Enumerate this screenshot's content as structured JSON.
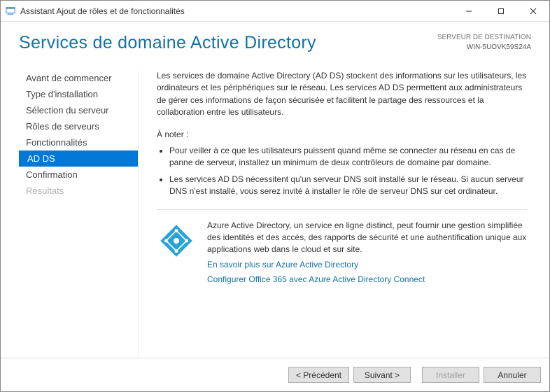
{
  "window": {
    "title": "Assistant Ajout de rôles et de fonctionnalités"
  },
  "header": {
    "page_title": "Services de domaine Active Directory",
    "destination_label": "SERVEUR DE DESTINATION",
    "destination_value": "WIN-5UOVK59S24A"
  },
  "nav": {
    "items": [
      {
        "label": "Avant de commencer",
        "state": "normal"
      },
      {
        "label": "Type d'installation",
        "state": "normal"
      },
      {
        "label": "Sélection du serveur",
        "state": "normal"
      },
      {
        "label": "Rôles de serveurs",
        "state": "normal"
      },
      {
        "label": "Fonctionnalités",
        "state": "normal"
      },
      {
        "label": "AD DS",
        "state": "selected"
      },
      {
        "label": "Confirmation",
        "state": "normal"
      },
      {
        "label": "Résultats",
        "state": "disabled"
      }
    ]
  },
  "main": {
    "intro": "Les services de domaine Active Directory (AD DS) stockent des informations sur les utilisateurs, les ordinateurs et les périphériques sur le réseau. Les services AD DS permettent aux administrateurs de gérer ces informations de façon sécurisée et facilitent le partage des ressources et la collaboration entre les utilisateurs.",
    "notes_heading": "À noter :",
    "notes": [
      "Pour veiller à ce que les utilisateurs puissent quand même se connecter au réseau en cas de panne de serveur, installez un minimum de deux contrôleurs de domaine par domaine.",
      "Les services AD DS nécessitent qu'un serveur DNS soit installé sur le réseau. Si aucun serveur DNS n'est installé, vous serez invité à installer le rôle de serveur DNS sur cet ordinateur."
    ],
    "azure": {
      "text": "Azure Active Directory, un service en ligne distinct, peut fournir une gestion simplifiée des identités et des accès, des rapports de sécurité et une authentification unique aux applications web dans le cloud et sur site.",
      "link1": "En savoir plus sur Azure Active Directory",
      "link2": "Configurer Office 365 avec Azure Active Directory Connect"
    }
  },
  "footer": {
    "previous": "< Précédent",
    "next": "Suivant >",
    "install": "Installer",
    "cancel": "Annuler"
  },
  "icons": {
    "minimize": "—",
    "maximize": "☐",
    "close": "✕"
  }
}
